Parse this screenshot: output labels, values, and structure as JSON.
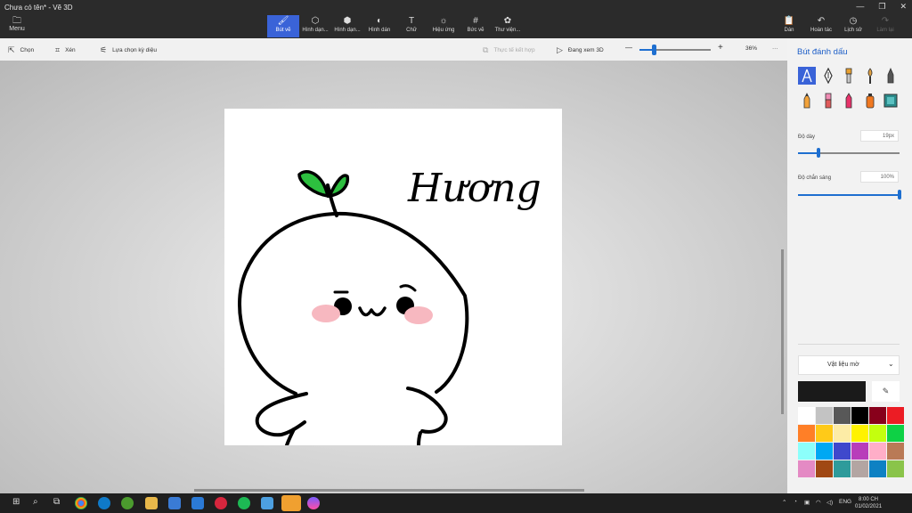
{
  "app": {
    "title": "Chưa có tên* - Vẽ 3D",
    "menu_label": "Menu"
  },
  "ribbon": {
    "tools": [
      {
        "label": "Bút vẽ",
        "icon": "brush-icon",
        "active": true
      },
      {
        "label": "Hình dạn...",
        "icon": "2d-shapes-icon",
        "active": false
      },
      {
        "label": "Hình dạn...",
        "icon": "3d-shapes-icon",
        "active": false
      },
      {
        "label": "Hình dán",
        "icon": "stickers-icon",
        "active": false
      },
      {
        "label": "Chữ",
        "icon": "text-icon",
        "active": false
      },
      {
        "label": "Hiệu ứng",
        "icon": "effects-icon",
        "active": false
      },
      {
        "label": "Bức vẽ",
        "icon": "canvas-icon",
        "active": false
      },
      {
        "label": "Thư viện...",
        "icon": "3d-library-icon",
        "active": false
      }
    ],
    "right_tools": [
      {
        "label": "Dán",
        "icon": "paste-icon",
        "disabled": false
      },
      {
        "label": "Hoàn tác",
        "icon": "undo-icon",
        "disabled": false
      },
      {
        "label": "Lịch sử",
        "icon": "history-icon",
        "disabled": false
      },
      {
        "label": "Làm lại",
        "icon": "redo-icon",
        "disabled": true
      }
    ]
  },
  "toolbar": {
    "select": "Chọn",
    "crop": "Xén",
    "magic_select": "Lựa chọn kỳ diệu",
    "mixed_reality": "Thực tế kết hợp",
    "view_3d": "Đang xem 3D",
    "zoom_out": "—",
    "zoom_in": "+",
    "zoom_value": "36%",
    "zoom_fraction": 0.2,
    "more": "···"
  },
  "canvas": {
    "handwriting": "Hương"
  },
  "panel": {
    "title": "Bút đánh dấu",
    "thickness_label": "Độ dày",
    "thickness_value": "19px",
    "thickness_fraction": 0.2,
    "opacity_label": "Độ chắn sáng",
    "opacity_value": "100%",
    "opacity_fraction": 1.0,
    "material": "Vật liệu mờ",
    "current_color": "#1a1a1a",
    "brushes": [
      "marker",
      "calligraphy-pen",
      "oil-brush",
      "watercolor",
      "pixel-pen",
      "pencil",
      "eraser",
      "crayon",
      "spraycan",
      "fill"
    ],
    "palette": [
      "#ffffff",
      "#c3c3c3",
      "#585858",
      "#000000",
      "#88001b",
      "#ec1c24",
      "#ff7f27",
      "#ffca18",
      "#fdeca6",
      "#fff200",
      "#c4ff0e",
      "#0ed145",
      "#8cfffb",
      "#00a8f3",
      "#3f48cc",
      "#b83dba",
      "#ffaec8",
      "#b97a56",
      "#e48ac4",
      "#a04814",
      "#2e9b9b",
      "#b3a5a2",
      "#0e81c3",
      "#8ac44a"
    ]
  },
  "taskbar": {
    "language": "ENG",
    "time": "8:00 CH",
    "date": "01/02/2021"
  }
}
